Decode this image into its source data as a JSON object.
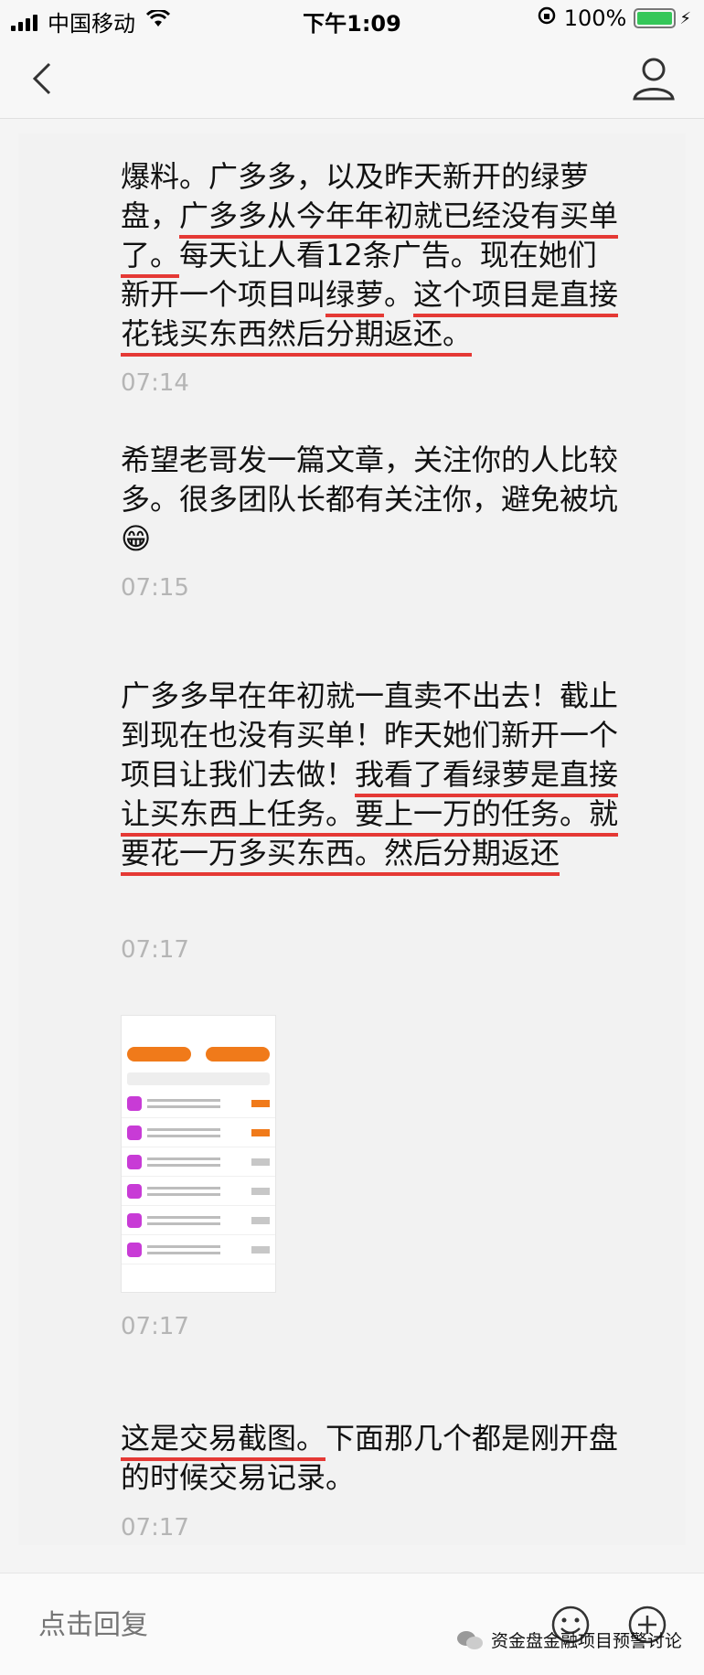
{
  "status_bar": {
    "carrier": "中国移动",
    "time": "下午1:09",
    "battery": "100%"
  },
  "messages": [
    {
      "id": "msg1",
      "text_segments": [
        "爆料。广多多，以及昨天新开的绿萝盘，",
        "广多多从今年年初就已经没有买单了。",
        "每天让人看12条广告。现在她们新开一个项目叫",
        "绿萝",
        "。",
        "这个项目是直接花钱买东西然后分期返还。"
      ],
      "time": "07:14"
    },
    {
      "id": "msg2",
      "text": "希望老哥发一篇文章，关注你的人比较多。很多团队长都有关注你，避免被坑",
      "time": "07:15"
    },
    {
      "id": "msg3",
      "text_segments": [
        "广多多早在年初就一直卖不出去！截止到现在也没有买单！昨天她们新开一个项目让我们去做！",
        "我看了看绿萝是直接让买东西上任务。",
        "要上一万的任务。就要花一万多买东西。然后分期返还"
      ],
      "time": "07:17"
    },
    {
      "id": "msg4",
      "time": "07:17"
    },
    {
      "id": "msg5",
      "text_segments": [
        "这是交易截图。",
        "下面那几个都是刚开盘的时候交易记录。"
      ],
      "time": "07:17"
    }
  ],
  "input_bar": {
    "placeholder": "点击回复"
  },
  "watermark": "资金盘金融项目预警讨论",
  "colors": {
    "underline": "#e53935",
    "timestamp": "#b5b5b5",
    "battery": "#35c759"
  }
}
